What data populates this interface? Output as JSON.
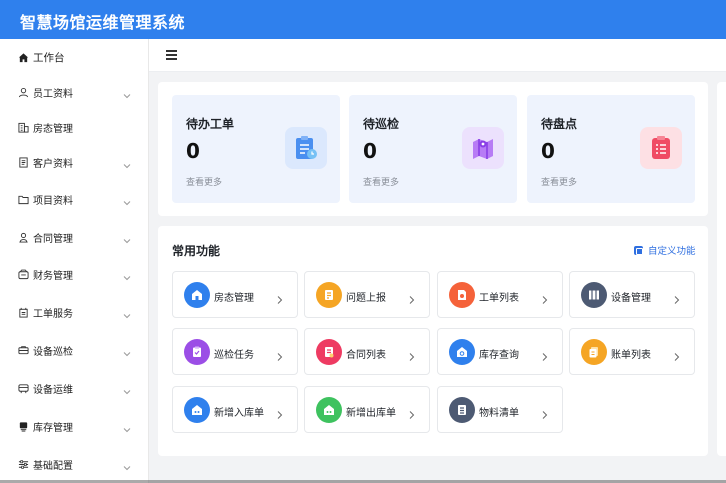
{
  "app": {
    "title": "智慧场馆运维管理系统"
  },
  "sidebar": {
    "items": [
      {
        "label": "工作台",
        "icon": "home-icon",
        "expandable": false
      },
      {
        "label": "员工资料",
        "icon": "user-icon",
        "expandable": true
      },
      {
        "label": "房态管理",
        "icon": "building-icon",
        "expandable": false
      },
      {
        "label": "客户资料",
        "icon": "document-icon",
        "expandable": true
      },
      {
        "label": "项目资料",
        "icon": "folder-icon",
        "expandable": true
      },
      {
        "label": "合同管理",
        "icon": "person-icon",
        "expandable": true
      },
      {
        "label": "财务管理",
        "icon": "wallet-icon",
        "expandable": true
      },
      {
        "label": "工单服务",
        "icon": "ticket-icon",
        "expandable": true
      },
      {
        "label": "设备巡检",
        "icon": "inspection-icon",
        "expandable": true
      },
      {
        "label": "设备运维",
        "icon": "maintenance-icon",
        "expandable": true
      },
      {
        "label": "库存管理",
        "icon": "stock-icon",
        "expandable": true
      },
      {
        "label": "基础配置",
        "icon": "sliders-icon",
        "expandable": true
      }
    ]
  },
  "stats": [
    {
      "title": "待办工单",
      "count": "0",
      "more": "查看更多",
      "icon": "clipboard-icon",
      "color": "#4a8ff0",
      "bg": "#dbe8fd"
    },
    {
      "title": "待巡检",
      "count": "0",
      "more": "查看更多",
      "icon": "map-icon",
      "color": "#a25bf0",
      "bg": "#ece1fd"
    },
    {
      "title": "待盘点",
      "count": "0",
      "more": "查看更多",
      "icon": "checklist-icon",
      "color": "#f04b64",
      "bg": "#fde0e4"
    }
  ],
  "functions": {
    "title": "常用功能",
    "customize": "自定义功能",
    "items": [
      {
        "label": "房态管理",
        "icon": "room-icon",
        "color": "#2f80ed"
      },
      {
        "label": "问题上报",
        "icon": "report-icon",
        "color": "#f5a524"
      },
      {
        "label": "工单列表",
        "icon": "work-order-icon",
        "color": "#f5623a"
      },
      {
        "label": "设备管理",
        "icon": "device-icon",
        "color": "#4d5a73"
      },
      {
        "label": "巡检任务",
        "icon": "patrol-icon",
        "color": "#9b4ee6"
      },
      {
        "label": "合同列表",
        "icon": "contract-icon",
        "color": "#ee3b62"
      },
      {
        "label": "库存查询",
        "icon": "inventory-search-icon",
        "color": "#2f80ed"
      },
      {
        "label": "账单列表",
        "icon": "bill-icon",
        "color": "#f5a524"
      },
      {
        "label": "新增入库单",
        "icon": "stock-in-icon",
        "color": "#2f80ed"
      },
      {
        "label": "新增出库单",
        "icon": "stock-out-icon",
        "color": "#3ec25f"
      },
      {
        "label": "物料清单",
        "icon": "material-list-icon",
        "color": "#4d5a73"
      }
    ]
  }
}
